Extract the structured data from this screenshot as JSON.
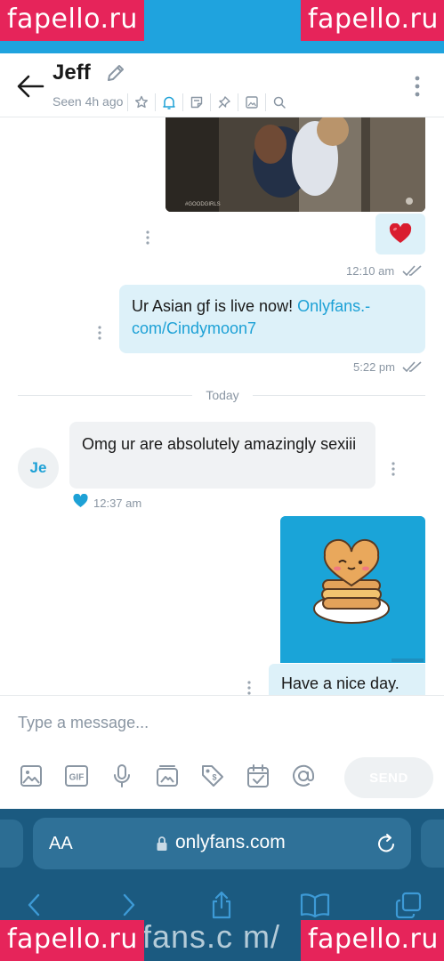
{
  "watermark": "fapello.ru",
  "header": {
    "name": "Jeff",
    "seen": "Seen 4h ago"
  },
  "messages": {
    "gif_caption": "#GOODGIRLS",
    "heart_time": "12:10 am",
    "outgoing_text": "Ur Asian gf is live now! ",
    "outgoing_link_1": "Onlyfans.-",
    "outgoing_link_2": "com/Cindymoon7",
    "outgoing_time": "5:22 pm",
    "day_divider": "Today",
    "avatar_initials": "Je",
    "incoming_text": "Omg ur are absolutely amazingly sexiii",
    "incoming_time": "12:37 am",
    "sticker_caption": "Have a nice day."
  },
  "composer": {
    "placeholder": "Type a message...",
    "send_label": "SEND",
    "gif_label": "GIF"
  },
  "browser": {
    "aa": "AA",
    "url": "onlyfans.com",
    "ghost_text": "fans.c m/"
  },
  "colors": {
    "accent": "#1da1d6",
    "status_bar": "#1fa3de",
    "watermark": "#e6245a",
    "bubble_out": "#ddf1f9",
    "bubble_in": "#f0f2f4",
    "browser": "#1b5a80"
  }
}
